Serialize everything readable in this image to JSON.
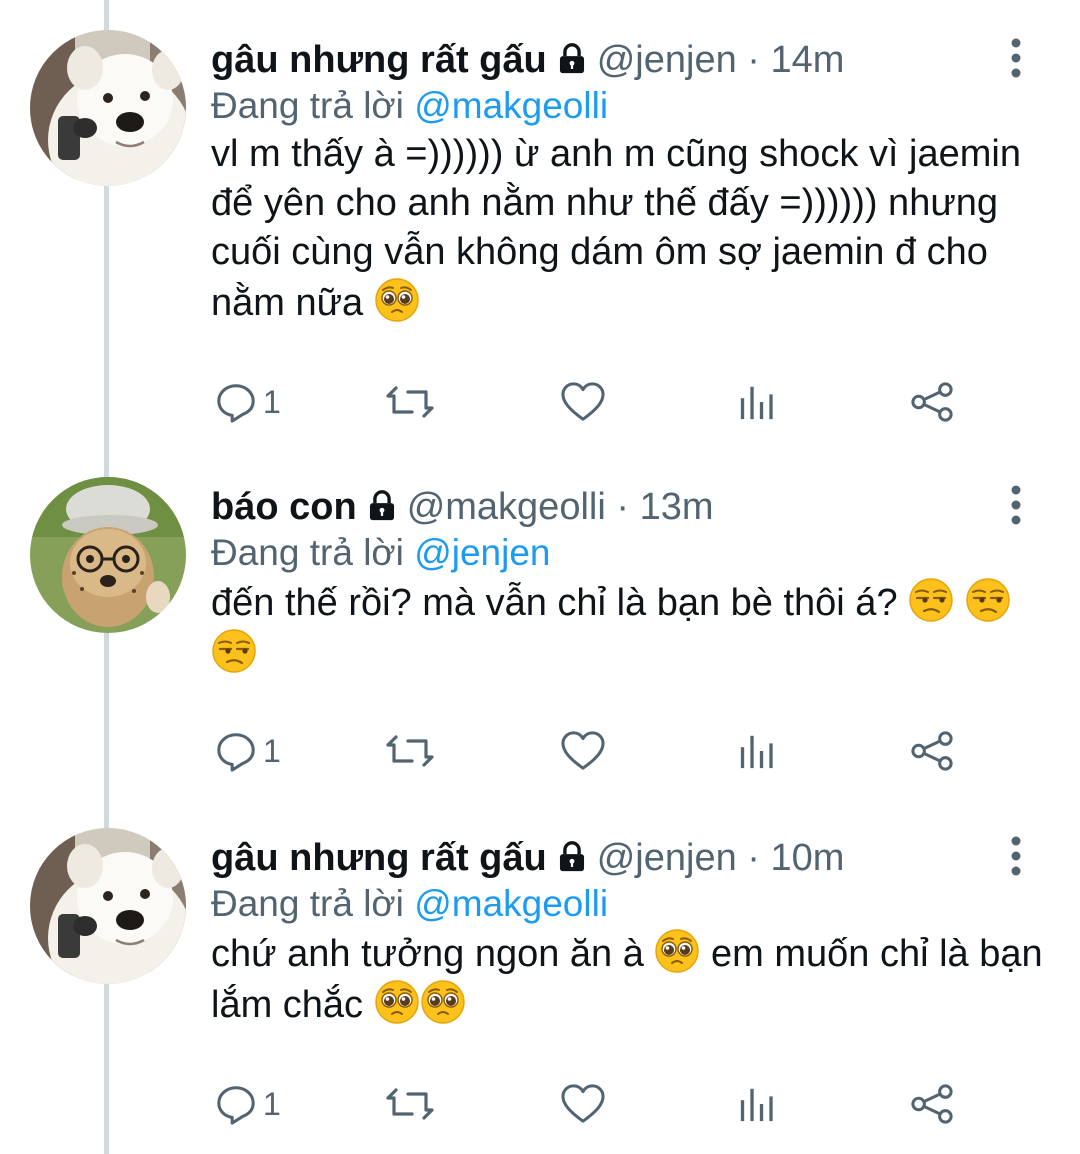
{
  "tweets": [
    {
      "name": "gâu nhưng rất gấu",
      "handle": "@jenjen",
      "separator": "·",
      "time": "14m",
      "reply_prefix": "Đang trả lời",
      "reply_to": "@makgeolli",
      "text": "vl m thấy à =)))))) ừ anh m cũng shock vì jaemin để yên cho anh nằm như thế đấy =)))))) nhưng cuối cùng vẫn không dám ôm sợ jaemin đ cho nằm nữa",
      "emojis": [
        "pleading-face-emoji"
      ],
      "reply_count": "1",
      "avatar_icon": "white-dog-avatar"
    },
    {
      "name": "báo con",
      "handle": "@makgeolli",
      "separator": "·",
      "time": "13m",
      "reply_prefix": "Đang trả lời",
      "reply_to": "@jenjen",
      "text": "đến thế rồi? mà vẫn chỉ là bạn bè thôi á?",
      "emojis": [
        "unamused-face-emoji",
        "unamused-face-emoji",
        "unamused-face-emoji"
      ],
      "reply_count": "1",
      "avatar_icon": "cheetah-cub-avatar"
    },
    {
      "name": "gâu nhưng rất gấu",
      "handle": "@jenjen",
      "separator": "·",
      "time": "10m",
      "reply_prefix": "Đang trả lời",
      "reply_to": "@makgeolli",
      "text_part1": "chứ anh tưởng ngon ăn à",
      "text_part2": "em muốn chỉ là bạn lắm chắc",
      "emojis": [
        "pleading-face-emoji",
        "pleading-face-emoji",
        "pleading-face-emoji"
      ],
      "reply_count": "1",
      "avatar_icon": "white-dog-avatar"
    }
  ],
  "icons": {
    "lock": "lock-icon",
    "more": "more-vertical-icon",
    "reply": "reply-icon",
    "retweet": "retweet-icon",
    "like": "like-icon",
    "views": "views-icon",
    "share": "share-icon"
  },
  "colors": {
    "accent": "#1d9bf0",
    "secondary_text": "#536471",
    "thread_line": "#cfd9de"
  }
}
